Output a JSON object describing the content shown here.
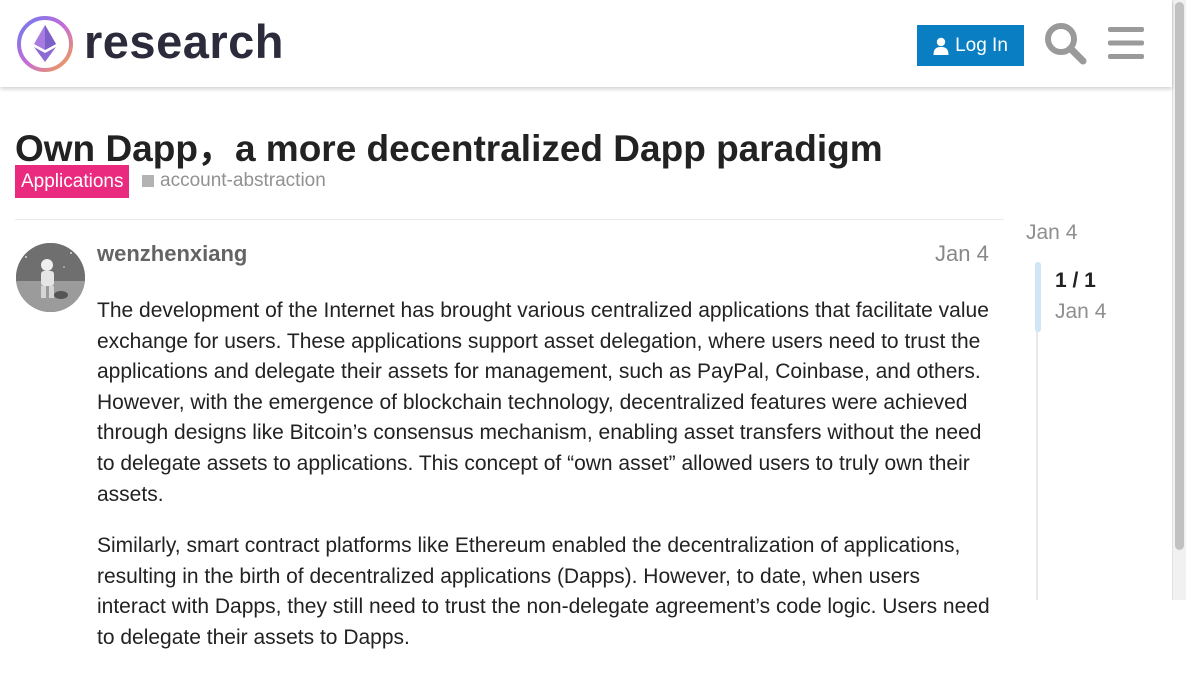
{
  "header": {
    "brand": "research",
    "login_label": "Log In"
  },
  "icons": {
    "logo": "ethereum-logo-icon",
    "search": "search-icon",
    "menu": "hamburger-menu-icon",
    "login": "person-icon"
  },
  "colors": {
    "accent": "#0a7ec2",
    "category": "#e92a7e",
    "tag_square": "#b3b3b3",
    "timeline_handle": "#d1e6f5"
  },
  "topic": {
    "title": "Own Dapp，a more decentralized Dapp paradigm",
    "category": "Applications",
    "tag": "account-abstraction"
  },
  "post": {
    "username": "wenzhenxiang",
    "date": "Jan 4",
    "paragraphs": [
      "The development of the Internet has brought various centralized applications that facilitate value exchange for users. These applications support asset delegation, where users need to trust the applications and delegate their assets for management, such as PayPal, Coinbase, and others. However, with the emergence of blockchain technology, decentralized features were achieved through designs like Bitcoin’s consensus mechanism, enabling asset transfers without the need to delegate assets to applications. This concept of “own asset” allowed users to truly own their assets.",
      "Similarly, smart contract platforms like Ethereum enabled the decentralization of applications, resulting in the birth of decentralized applications (Dapps). However, to date, when users interact with Dapps, they still need to trust the non-delegate agreement’s code logic. Users need to delegate their assets to Dapps."
    ]
  },
  "timeline": {
    "start_date": "Jan 4",
    "progress": "1 / 1",
    "current_date": "Jan 4"
  }
}
